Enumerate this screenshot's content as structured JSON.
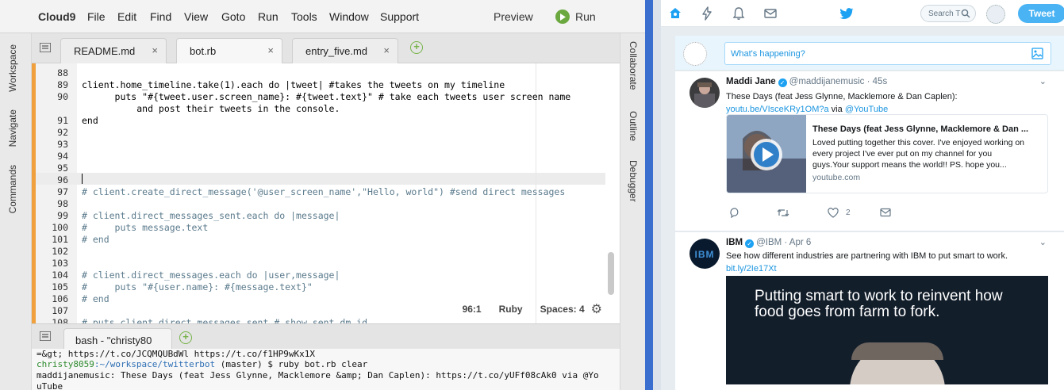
{
  "cloud9": {
    "brand": "Cloud9",
    "menu": [
      "File",
      "Edit",
      "Find",
      "View",
      "Goto",
      "Run",
      "Tools",
      "Window",
      "Support"
    ],
    "preview_label": "Preview",
    "run_label": "Run",
    "left_panels": [
      "Workspace",
      "Navigate",
      "Commands"
    ],
    "right_panels": [
      "Collaborate",
      "Outline",
      "Debugger"
    ],
    "tabs": [
      {
        "label": "README.md",
        "close": "×"
      },
      {
        "label": "bot.rb",
        "close": "×"
      },
      {
        "label": "entry_five.md",
        "close": "×"
      }
    ],
    "add_tab": "+",
    "editor": {
      "lines": [
        {
          "num": "88",
          "text": ""
        },
        {
          "num": "89",
          "text": "client.home_timeline.take(1).each do |tweet| #takes the tweets on my timeline"
        },
        {
          "num": "90",
          "text": "      puts \"#{tweet.user.screen_name}: #{tweet.text}\" # take each tweets user screen name"
        },
        {
          "num": "",
          "text": "          and post their tweets in the console."
        },
        {
          "num": "91",
          "text": "end"
        },
        {
          "num": "92",
          "text": ""
        },
        {
          "num": "93",
          "text": ""
        },
        {
          "num": "94",
          "text": ""
        },
        {
          "num": "95",
          "text": ""
        },
        {
          "num": "96",
          "text": ""
        },
        {
          "num": "97",
          "text": "# client.create_direct_message('@user_screen_name',\"Hello, world\") #send direct messages"
        },
        {
          "num": "98",
          "text": ""
        },
        {
          "num": "99",
          "text": "# client.direct_messages_sent.each do |message|"
        },
        {
          "num": "100",
          "text": "#     puts message.text"
        },
        {
          "num": "101",
          "text": "# end"
        },
        {
          "num": "102",
          "text": ""
        },
        {
          "num": "103",
          "text": ""
        },
        {
          "num": "104",
          "text": "# client.direct_messages.each do |user,message|"
        },
        {
          "num": "105",
          "text": "#     puts \"#{user.name}: #{message.text}\""
        },
        {
          "num": "106",
          "text": "# end"
        },
        {
          "num": "107",
          "text": ""
        },
        {
          "num": "108",
          "text": "# puts client.direct_messages_sent # show sent dm id"
        }
      ],
      "status": {
        "position": "96:1",
        "language": "Ruby",
        "spaces": "Spaces: 4"
      }
    },
    "terminal": {
      "tab_label": "bash - \"christy80",
      "add_tab": "+",
      "lines": [
        {
          "text": "=&gt; https://t.co/JCQMQUBdWl https://t.co/f1HP9wKx1X"
        },
        {
          "user": "christy8059",
          "path": ":~/workspace/twitterbot",
          "rest": " (master) $ ruby bot.rb clear"
        },
        {
          "text": "maddijanemusic: These Days (feat Jess Glynne, Macklemore &amp; Dan Caplen): https://t.co/yUFf08cAk0 via @Yo"
        },
        {
          "text": "uTube"
        }
      ]
    }
  },
  "twitter": {
    "search_placeholder": "Search T",
    "tweet_button": "Tweet",
    "compose_placeholder": "What's happening?",
    "tweets": [
      {
        "name": "Maddi Jane",
        "handle": "@maddijanemusic",
        "time": "· 45s",
        "text": "These Days (feat Jess Glynne, Macklemore & Dan Caplen):",
        "link": "youtu.be/VIsceKRy1OM?a",
        "via": " via ",
        "mention": "@YouTube",
        "card": {
          "title": "These Days (feat Jess Glynne, Macklemore & Dan ...",
          "desc": [
            "Loved putting together this cover. I've enjoyed working on",
            "every project I've ever put on my channel for you",
            "guys.Your support means the world!! PS. hope you..."
          ],
          "domain": "youtube.com"
        },
        "likes": "2"
      },
      {
        "name": "IBM",
        "handle": "@IBM",
        "time": "· Apr 6",
        "text": "See how different industries are partnering with IBM to put smart to work.",
        "link": "bit.ly/2Ie17Xt",
        "promo": "Putting smart to work to reinvent how food goes from farm to fork."
      }
    ],
    "colors": {
      "brand": "#1da1f2",
      "link": "#1b95e0",
      "tweet_button": "#4ab3f4"
    }
  }
}
